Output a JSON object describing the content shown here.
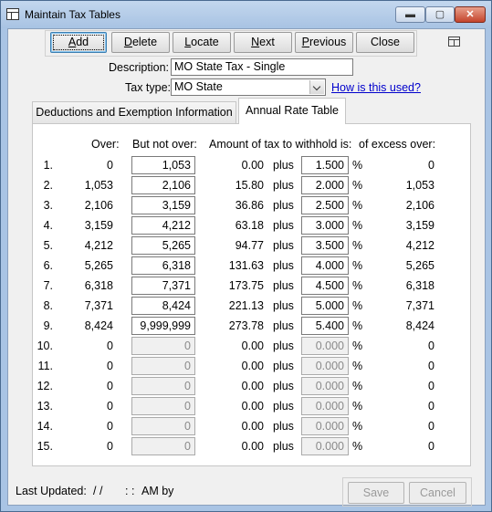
{
  "window": {
    "title": "Maintain Tax Tables",
    "controls": {
      "minimize": "▬",
      "maximize": "▢",
      "close": "✕"
    }
  },
  "toolbar": {
    "add": {
      "pre": "",
      "ul": "A",
      "post": "dd"
    },
    "delete": {
      "pre": "",
      "ul": "D",
      "post": "elete"
    },
    "locate": {
      "pre": "",
      "ul": "L",
      "post": "ocate"
    },
    "next": {
      "pre": "",
      "ul": "N",
      "post": "ext"
    },
    "previous": {
      "pre": "",
      "ul": "P",
      "post": "revious"
    },
    "close": {
      "pre": "",
      "ul": "",
      "post": "Close"
    }
  },
  "form": {
    "description_label": "Description:",
    "description_value": "MO State Tax - Single",
    "tax_type_label": "Tax type:",
    "tax_type_value": "MO State",
    "how_link": "How is this used?"
  },
  "tabs": [
    {
      "label": "Deductions and Exemption Information",
      "active": false
    },
    {
      "label": "Annual Rate Table",
      "active": true
    }
  ],
  "table": {
    "headers": {
      "over": "Over:",
      "but_not_over": "But not over:",
      "amount": "Amount of tax to withhold is:",
      "excess_over": "of excess over:"
    },
    "plus_text": "plus",
    "percent_text": "%",
    "rows": [
      {
        "num": "1.",
        "over": "0",
        "but_not_over": "1,053",
        "amount": "0.00",
        "rate": "1.500",
        "excess_over": "0",
        "enabled": true
      },
      {
        "num": "2.",
        "over": "1,053",
        "but_not_over": "2,106",
        "amount": "15.80",
        "rate": "2.000",
        "excess_over": "1,053",
        "enabled": true
      },
      {
        "num": "3.",
        "over": "2,106",
        "but_not_over": "3,159",
        "amount": "36.86",
        "rate": "2.500",
        "excess_over": "2,106",
        "enabled": true
      },
      {
        "num": "4.",
        "over": "3,159",
        "but_not_over": "4,212",
        "amount": "63.18",
        "rate": "3.000",
        "excess_over": "3,159",
        "enabled": true
      },
      {
        "num": "5.",
        "over": "4,212",
        "but_not_over": "5,265",
        "amount": "94.77",
        "rate": "3.500",
        "excess_over": "4,212",
        "enabled": true
      },
      {
        "num": "6.",
        "over": "5,265",
        "but_not_over": "6,318",
        "amount": "131.63",
        "rate": "4.000",
        "excess_over": "5,265",
        "enabled": true
      },
      {
        "num": "7.",
        "over": "6,318",
        "but_not_over": "7,371",
        "amount": "173.75",
        "rate": "4.500",
        "excess_over": "6,318",
        "enabled": true
      },
      {
        "num": "8.",
        "over": "7,371",
        "but_not_over": "8,424",
        "amount": "221.13",
        "rate": "5.000",
        "excess_over": "7,371",
        "enabled": true
      },
      {
        "num": "9.",
        "over": "8,424",
        "but_not_over": "9,999,999",
        "amount": "273.78",
        "rate": "5.400",
        "excess_over": "8,424",
        "enabled": true
      },
      {
        "num": "10.",
        "over": "0",
        "but_not_over": "0",
        "amount": "0.00",
        "rate": "0.000",
        "excess_over": "0",
        "enabled": false
      },
      {
        "num": "11.",
        "over": "0",
        "but_not_over": "0",
        "amount": "0.00",
        "rate": "0.000",
        "excess_over": "0",
        "enabled": false
      },
      {
        "num": "12.",
        "over": "0",
        "but_not_over": "0",
        "amount": "0.00",
        "rate": "0.000",
        "excess_over": "0",
        "enabled": false
      },
      {
        "num": "13.",
        "over": "0",
        "but_not_over": "0",
        "amount": "0.00",
        "rate": "0.000",
        "excess_over": "0",
        "enabled": false
      },
      {
        "num": "14.",
        "over": "0",
        "but_not_over": "0",
        "amount": "0.00",
        "rate": "0.000",
        "excess_over": "0",
        "enabled": false
      },
      {
        "num": "15.",
        "over": "0",
        "but_not_over": "0",
        "amount": "0.00",
        "rate": "0.000",
        "excess_over": "0",
        "enabled": false
      }
    ]
  },
  "footer": {
    "last_updated_label": "Last Updated:",
    "date_value": "/ /",
    "time_value": ": :",
    "ampm_by": "AM by",
    "save": "Save",
    "cancel": "Cancel"
  }
}
